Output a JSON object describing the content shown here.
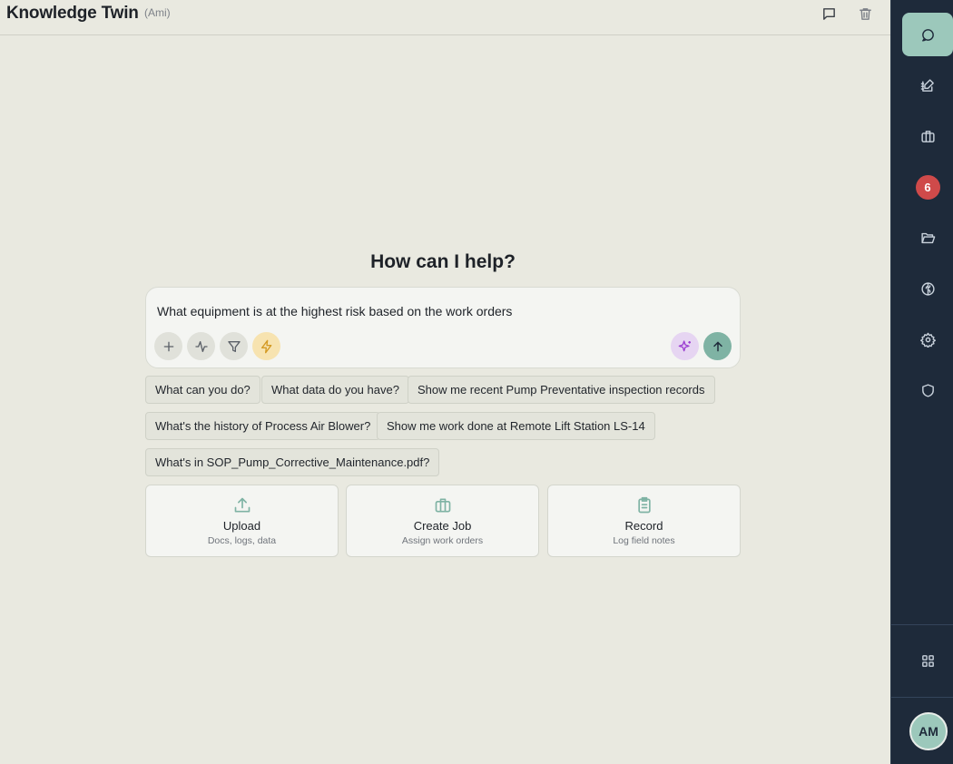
{
  "header": {
    "title": "Knowledge Twin",
    "subtitle": "(Ami)",
    "icons": [
      "chat-bubble-icon",
      "trash-icon"
    ]
  },
  "main": {
    "heading": "How can I help?",
    "composer": {
      "value": "What equipment is at the highest risk based on the work orders",
      "tools": [
        "plus-icon",
        "activity-icon",
        "filter-icon",
        "lightning-icon",
        "sparkles-icon",
        "send-arrow-icon"
      ]
    },
    "suggestions": [
      "What can you do?",
      "What data do you have?",
      "Show me recent Pump Preventative inspection records",
      "What's the history of Process Air Blower?",
      "Show me work done at Remote Lift Station LS-14",
      "What's in SOP_Pump_Corrective_Maintenance.pdf?"
    ],
    "cards": [
      {
        "title": "Upload",
        "subtitle": "Docs, logs, data",
        "icon": "upload-icon"
      },
      {
        "title": "Create Job",
        "subtitle": "Assign work orders",
        "icon": "briefcase-icon"
      },
      {
        "title": "Record",
        "subtitle": "Log field notes",
        "icon": "clipboard-icon"
      }
    ]
  },
  "sidebar": {
    "items": [
      {
        "icon": "chat-icon",
        "active": true
      },
      {
        "icon": "edit-note-icon"
      },
      {
        "icon": "briefcase-icon"
      },
      {
        "badge": "6"
      },
      {
        "icon": "folder-open-icon"
      },
      {
        "icon": "brain-icon"
      },
      {
        "icon": "gear-icon"
      },
      {
        "icon": "shield-icon"
      }
    ],
    "bottom_icon": "grid-icon",
    "avatar": "AM"
  },
  "colors": {
    "background": "#e9e9e0",
    "sidebar": "#1e2a3a",
    "accent": "#9cc8bb",
    "badge": "#cf4a4a",
    "lightning_bg": "#f7e3b0",
    "sparkle_bg": "#e6d5f2",
    "send_bg": "#7fb3a4"
  }
}
